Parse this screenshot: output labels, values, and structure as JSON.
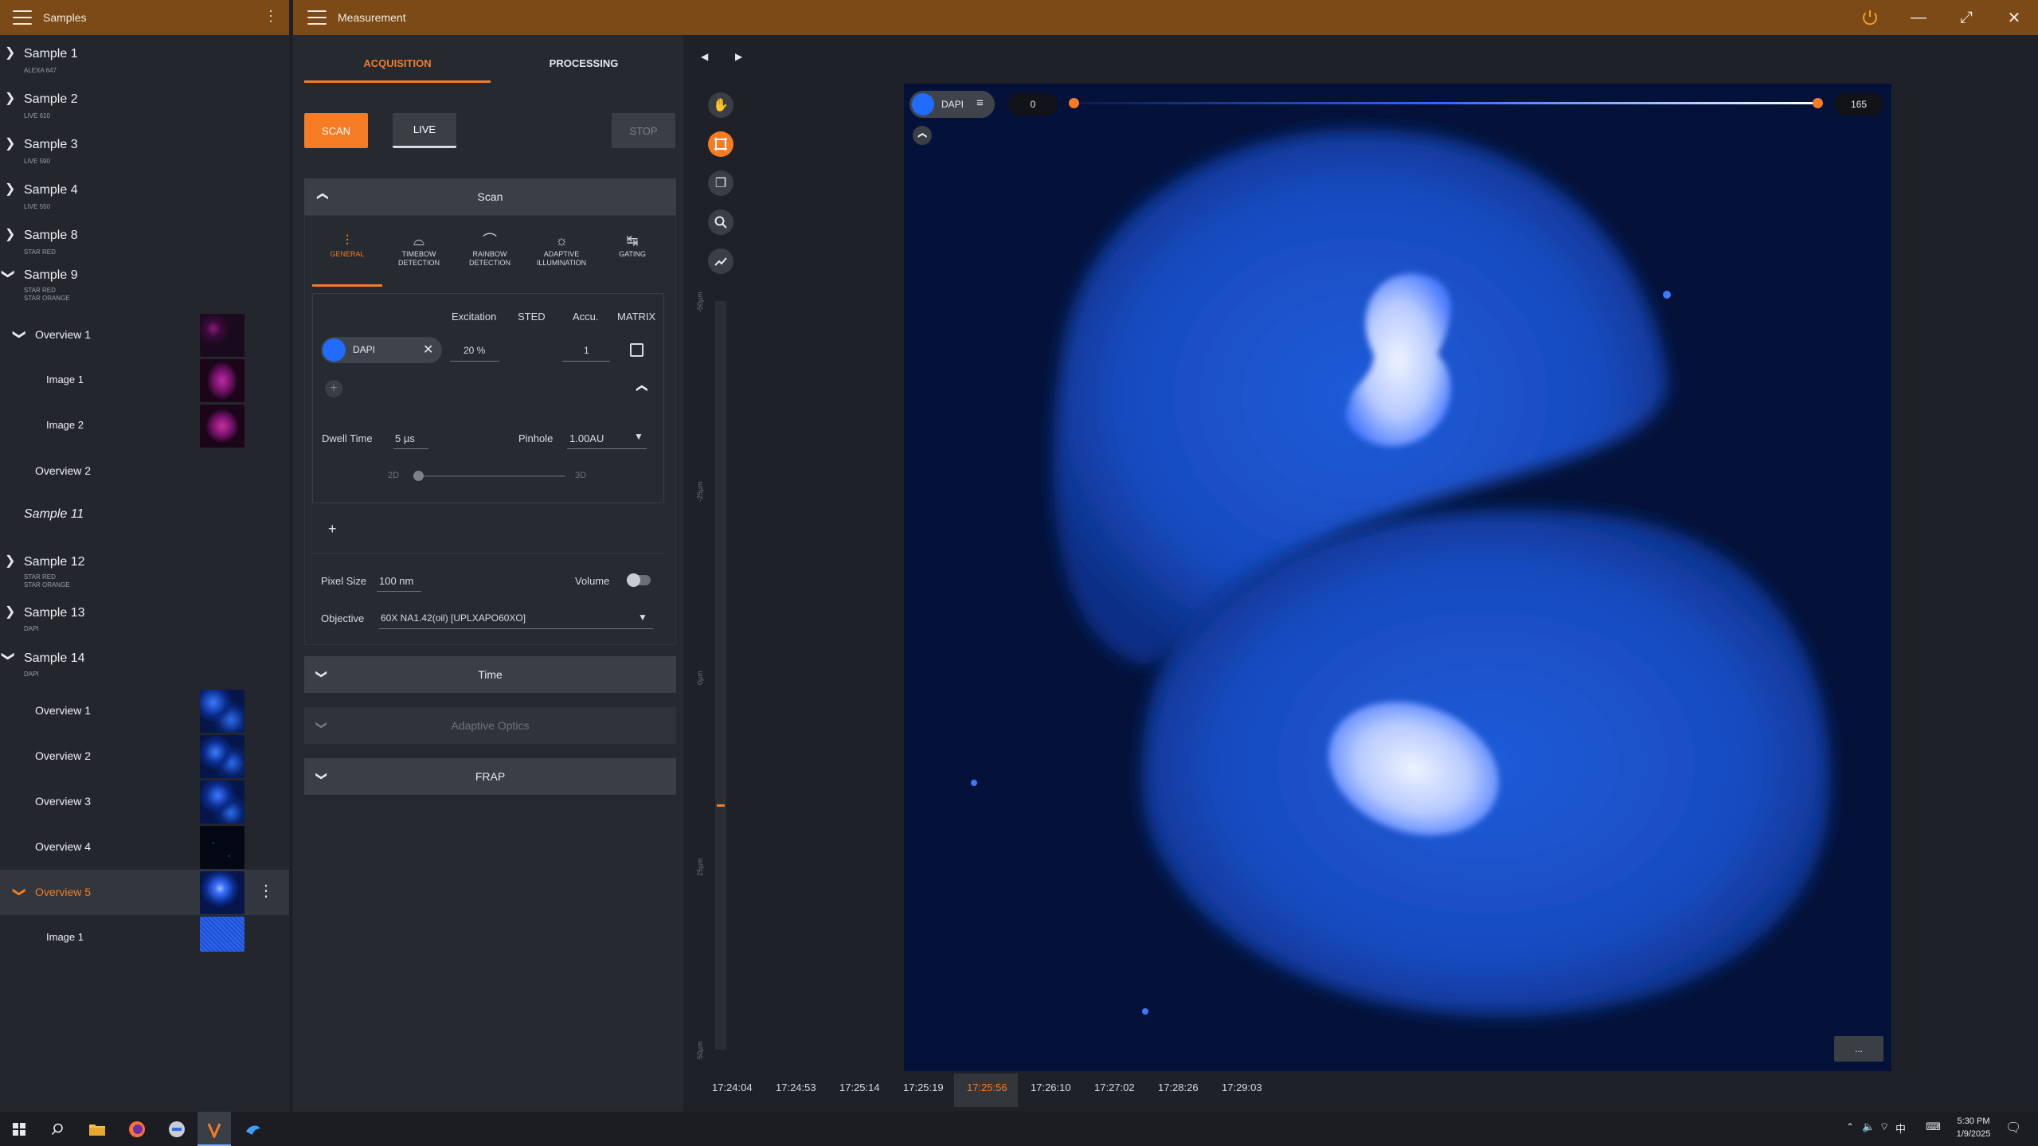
{
  "left_panel": {
    "title": "Samples"
  },
  "window": {
    "title": "Measurement",
    "minimize": "—",
    "restore": "⤢",
    "close": "✕"
  },
  "samples": [
    {
      "name": "Sample 1",
      "sub": [
        "Alexa 647"
      ]
    },
    {
      "name": "Sample 2",
      "sub": [
        "LIVE 610"
      ]
    },
    {
      "name": "Sample 3",
      "sub": [
        "LIVE 590"
      ]
    },
    {
      "name": "Sample 4",
      "sub": [
        "LIVE 550"
      ]
    },
    {
      "name": "Sample 8",
      "sub": [
        "STAR RED"
      ]
    },
    {
      "name": "Sample 9",
      "sub": [
        "STAR RED",
        "STAR ORANGE"
      ]
    },
    {
      "name": "Sample 11",
      "sub": []
    },
    {
      "name": "Sample 12",
      "sub": [
        "STAR RED",
        "STAR ORANGE"
      ]
    },
    {
      "name": "Sample 13",
      "sub": [
        "DAPI"
      ]
    },
    {
      "name": "Sample 14",
      "sub": [
        "DAPI"
      ]
    }
  ],
  "sample9_children": [
    "Overview 1",
    "Image 1",
    "Image 2",
    "Overview 2"
  ],
  "sample14_children": [
    "Overview 1",
    "Overview 2",
    "Overview 3",
    "Overview 4",
    "Overview 5",
    "Image 1"
  ],
  "tabs": {
    "acquisition": "ACQUISITION",
    "processing": "PROCESSING"
  },
  "actions": {
    "scan": "SCAN",
    "live": "LIVE",
    "stop": "STOP"
  },
  "panels": {
    "scan": "Scan",
    "time": "Time",
    "adaptive_optics": "Adaptive Optics",
    "frap": "FRAP"
  },
  "modes": [
    {
      "icon": "sliders-icon",
      "label": [
        "GENERAL"
      ]
    },
    {
      "icon": "timebow-icon",
      "label": [
        "TIMEBOW",
        "DETECTION"
      ]
    },
    {
      "icon": "rainbow-icon",
      "label": [
        "RAINBOW",
        "DETECTION"
      ]
    },
    {
      "icon": "sun-icon",
      "label": [
        "ADAPTIVE",
        "ILLUMINATION"
      ]
    },
    {
      "icon": "gating-icon",
      "label": [
        "GATING"
      ]
    }
  ],
  "channel_table": {
    "headers": [
      "Excitation",
      "STED",
      "Accu.",
      "MATRIX"
    ],
    "channel": "DAPI",
    "excitation": "20 %",
    "accu": "1"
  },
  "dwell": {
    "label": "Dwell Time",
    "value": "5 µs"
  },
  "pinhole": {
    "label": "Pinhole",
    "value": "1.00AU"
  },
  "dimension": {
    "left": "2D",
    "right": "3D"
  },
  "pixel_size": {
    "label": "Pixel Size",
    "value": "100 nm"
  },
  "volume": {
    "label": "Volume"
  },
  "objective": {
    "label": "Objective",
    "value": "60X NA1.42(oil) [UPLXAPO60XO]"
  },
  "viewer": {
    "channel": "DAPI",
    "range_min": "0",
    "range_max": "165",
    "z_ticks": [
      "-50µm",
      "-25µm",
      "0µm",
      "25µm",
      "50µm"
    ],
    "more": "..."
  },
  "timeline": [
    "17:24:04",
    "17:24:53",
    "17:25:14",
    "17:25:19",
    "17:25:56",
    "17:26:10",
    "17:27:02",
    "17:28:26",
    "17:29:03"
  ],
  "timeline_active": "17:25:56",
  "taskbar": {
    "time": "5:30 PM",
    "date": "1/9/2025"
  },
  "colors": {
    "accent": "#f57c25",
    "titlebar": "#7c4a16",
    "channel_blue": "#1f6cff"
  }
}
